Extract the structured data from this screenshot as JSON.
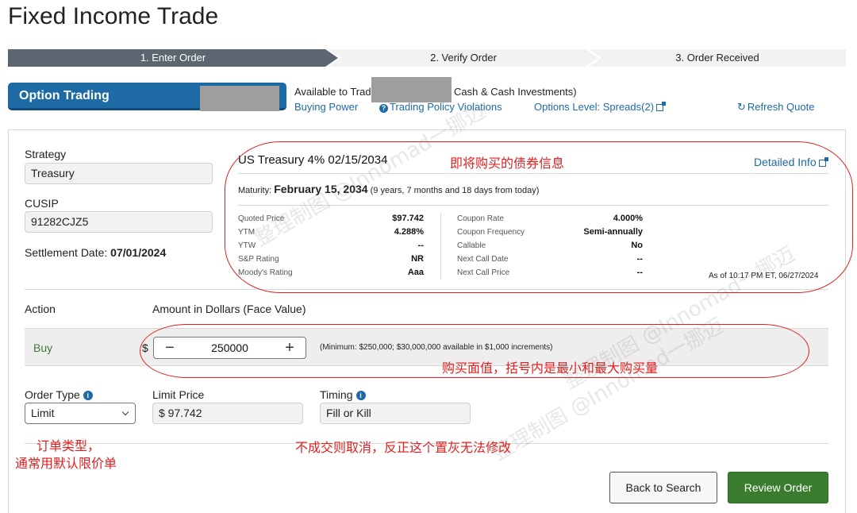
{
  "page": {
    "title": "Fixed Income Trade"
  },
  "steps": [
    {
      "label": "1. Enter Order",
      "active": true
    },
    {
      "label": "2. Verify Order",
      "active": false
    },
    {
      "label": "3. Order Received",
      "active": false
    }
  ],
  "account_bar": {
    "option_label": "Option Trading",
    "available_prefix": "Available to Trade",
    "available_suffix": "Cash & Cash Investments)",
    "links": {
      "buying_power": "Buying Power",
      "policy_violations": "Trading Policy Violations",
      "options_level": "Options Level: Spreads(2)",
      "refresh_quote": "Refresh Quote"
    }
  },
  "left_fields": {
    "strategy_label": "Strategy",
    "strategy_value": "Treasury",
    "cusip_label": "CUSIP",
    "cusip_value": "91282CJZ5",
    "settlement_label": "Settlement Date:",
    "settlement_value": "07/01/2024"
  },
  "bond": {
    "title": "US Treasury 4% 02/15/2034",
    "detail_link": "Detailed Info",
    "maturity_label": "Maturity:",
    "maturity_date": "February 15, 2034",
    "maturity_note": "(9 years, 7 months and 18 days from today)",
    "left_rows": [
      {
        "label": "Quoted Price",
        "value": "$97.742"
      },
      {
        "label": "YTM",
        "value": "4.288%"
      },
      {
        "label": "YTW",
        "value": "--"
      },
      {
        "label": "S&P Rating",
        "value": "NR"
      },
      {
        "label": "Moody's Rating",
        "value": "Aaa"
      }
    ],
    "right_rows": [
      {
        "label": "Coupon Rate",
        "value": "4.000%"
      },
      {
        "label": "Coupon Frequency",
        "value": "Semi-annually"
      },
      {
        "label": "Callable",
        "value": "No"
      },
      {
        "label": "Next Call Date",
        "value": "--"
      },
      {
        "label": "Next Call Price",
        "value": "--"
      }
    ],
    "as_of": "As of 10:17 PM ET, 06/27/2024"
  },
  "order": {
    "action_label": "Action",
    "amount_label": "Amount in Dollars (Face Value)",
    "action_value": "Buy",
    "currency_symbol": "$",
    "amount_value": "250000",
    "minus_symbol": "−",
    "plus_symbol": "+",
    "amount_note": "(Minimum: $250,000; $30,000,000 available in $1,000 increments)",
    "order_type_label": "Order Type",
    "order_type_value": "Limit",
    "limit_price_label": "Limit Price",
    "limit_price_value": "$ 97.742",
    "timing_label": "Timing",
    "timing_value": "Fill or Kill",
    "info_symbol": "i",
    "help_symbol": "?"
  },
  "buttons": {
    "back": "Back to Search",
    "review": "Review Order"
  },
  "annotations": {
    "bond_info": "即将购买的债券信息",
    "face_value": "购买面值，括号内是最小和最大购买量",
    "order_type_line1": "订单类型，",
    "order_type_line2": "通常用默认限价单",
    "timing_note": "不成交则取消，反正这个置灰无法修改",
    "color": "#e02020"
  },
  "watermarks": [
    "整理制图 @Innomad一挪迈",
    "整理制图 @Innomad一挪迈",
    "整理制图 @Innomad一挪迈"
  ]
}
